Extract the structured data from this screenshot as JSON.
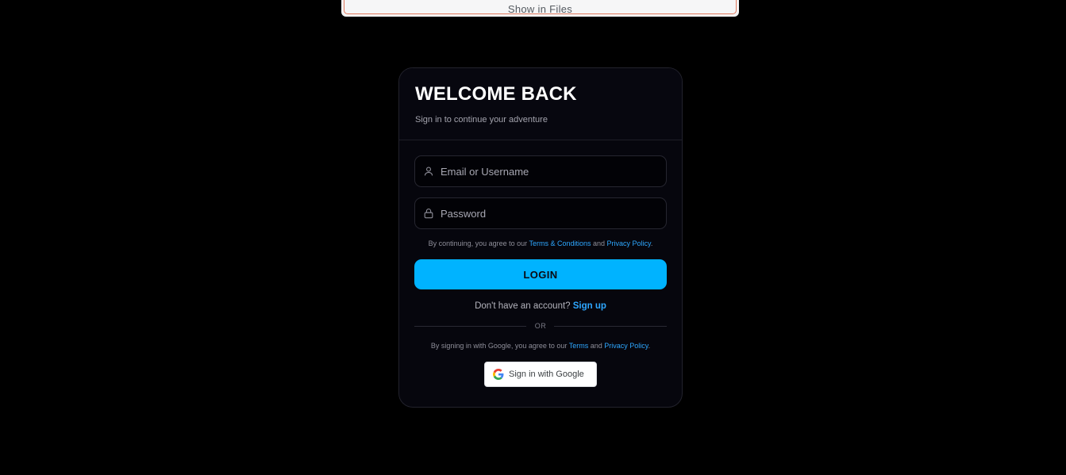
{
  "top_popup": {
    "label": "Show in Files"
  },
  "login_card": {
    "title": "WELCOME BACK",
    "subtitle": "Sign in to continue your adventure",
    "email_field": {
      "placeholder": "Email or Username",
      "value": "",
      "icon": "user-icon"
    },
    "password_field": {
      "placeholder": "Password",
      "value": "",
      "icon": "lock-icon"
    },
    "legal": {
      "prefix": "By continuing, you agree to our ",
      "terms_link": "Terms & Conditions",
      "middle": " and ",
      "privacy_link": "Privacy Policy",
      "suffix": "."
    },
    "login_button": "LOGIN",
    "signup": {
      "prompt": "Don't have an account? ",
      "link": "Sign up"
    },
    "divider_text": "OR",
    "google_legal": {
      "prefix": "By signing in with Google, you agree to our ",
      "terms_link": "Terms",
      "middle": " and ",
      "privacy_link": "Privacy Policy",
      "suffix": "."
    },
    "google_button": {
      "label": "Sign in with Google",
      "icon": "google-icon"
    }
  },
  "colors": {
    "background": "#000000",
    "card": "#06060d",
    "accent": "#00b3ff",
    "link": "#2ea7ff"
  }
}
